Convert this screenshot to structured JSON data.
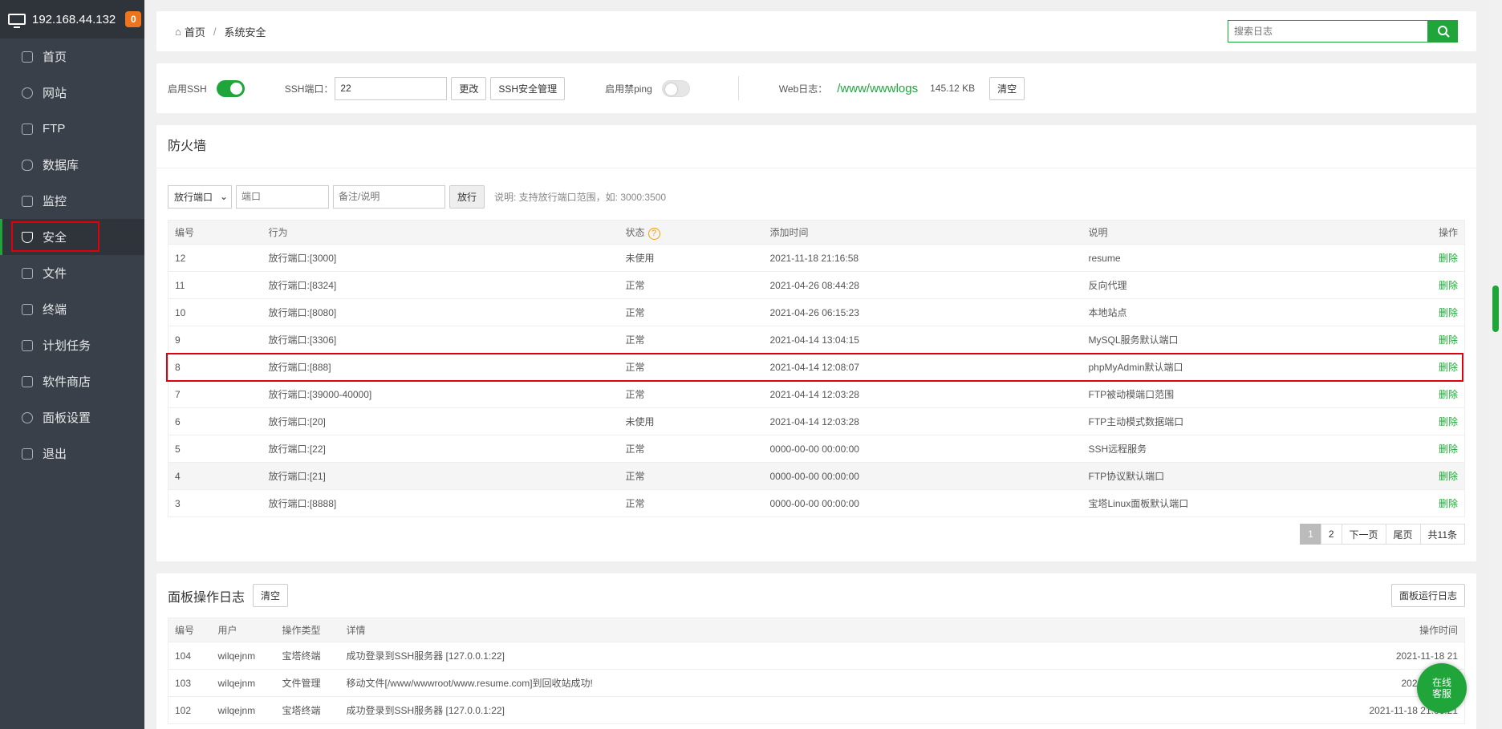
{
  "sidebar": {
    "ip": "192.168.44.132",
    "badge": "0",
    "items": [
      {
        "label": "首页",
        "icon": "home-icon"
      },
      {
        "label": "网站",
        "icon": "globe-icon"
      },
      {
        "label": "FTP",
        "icon": "ftp-icon"
      },
      {
        "label": "数据库",
        "icon": "database-icon"
      },
      {
        "label": "监控",
        "icon": "monitor-icon"
      },
      {
        "label": "安全",
        "icon": "shield-icon"
      },
      {
        "label": "文件",
        "icon": "folder-icon"
      },
      {
        "label": "终端",
        "icon": "terminal-icon"
      },
      {
        "label": "计划任务",
        "icon": "calendar-icon"
      },
      {
        "label": "软件商店",
        "icon": "grid-icon"
      },
      {
        "label": "面板设置",
        "icon": "gear-icon"
      },
      {
        "label": "退出",
        "icon": "logout-icon"
      }
    ]
  },
  "breadcrumb": {
    "home": "首页",
    "sep": "/",
    "current": "系统安全"
  },
  "search": {
    "placeholder": "搜索日志"
  },
  "options": {
    "ssh_label": "启用SSH",
    "ssh_port_label": "SSH端口：",
    "ssh_port_value": "22",
    "change_btn": "更改",
    "ssh_manage_btn": "SSH安全管理",
    "ping_label": "启用禁ping",
    "weblog_label": "Web日志：",
    "weblog_path": "/www/wwwlogs",
    "weblog_size": "145.12 KB",
    "clear_btn": "清空"
  },
  "firewall": {
    "title": "防火墙",
    "select_value": "放行端口",
    "port_placeholder": "端口",
    "note_placeholder": "备注/说明",
    "allow_btn": "放行",
    "hint": "说明: 支持放行端口范围，如: 3000:3500",
    "columns": [
      "编号",
      "行为",
      "状态",
      "添加时间",
      "说明",
      "操作"
    ],
    "rows": [
      {
        "id": "12",
        "action": "放行端口:[3000]",
        "status": "未使用",
        "time": "2021-11-18 21:16:58",
        "desc": "resume",
        "op": "删除"
      },
      {
        "id": "11",
        "action": "放行端口:[8324]",
        "status": "正常",
        "time": "2021-04-26 08:44:28",
        "desc": "反向代理",
        "op": "删除"
      },
      {
        "id": "10",
        "action": "放行端口:[8080]",
        "status": "正常",
        "time": "2021-04-26 06:15:23",
        "desc": "本地站点",
        "op": "删除"
      },
      {
        "id": "9",
        "action": "放行端口:[3306]",
        "status": "正常",
        "time": "2021-04-14 13:04:15",
        "desc": "MySQL服务默认端口",
        "op": "删除"
      },
      {
        "id": "8",
        "action": "放行端口:[888]",
        "status": "正常",
        "time": "2021-04-14 12:08:07",
        "desc": "phpMyAdmin默认端口",
        "op": "删除"
      },
      {
        "id": "7",
        "action": "放行端口:[39000-40000]",
        "status": "正常",
        "time": "2021-04-14 12:03:28",
        "desc": "FTP被动模端口范围",
        "op": "删除"
      },
      {
        "id": "6",
        "action": "放行端口:[20]",
        "status": "未使用",
        "time": "2021-04-14 12:03:28",
        "desc": "FTP主动模式数据端口",
        "op": "删除"
      },
      {
        "id": "5",
        "action": "放行端口:[22]",
        "status": "正常",
        "time": "0000-00-00 00:00:00",
        "desc": "SSH远程服务",
        "op": "删除"
      },
      {
        "id": "4",
        "action": "放行端口:[21]",
        "status": "正常",
        "time": "0000-00-00 00:00:00",
        "desc": "FTP协议默认端口",
        "op": "删除"
      },
      {
        "id": "3",
        "action": "放行端口:[8888]",
        "status": "正常",
        "time": "0000-00-00 00:00:00",
        "desc": "宝塔Linux面板默认端口",
        "op": "删除"
      }
    ],
    "pager": {
      "p1": "1",
      "p2": "2",
      "next": "下一页",
      "last": "尾页",
      "total": "共11条"
    }
  },
  "panel_log": {
    "title": "面板操作日志",
    "clear_btn": "清空",
    "run_log_btn": "面板运行日志",
    "columns": [
      "编号",
      "用户",
      "操作类型",
      "详情",
      "操作时间"
    ],
    "rows": [
      {
        "id": "104",
        "user": "wilqejnm",
        "type": "宝塔终端",
        "detail": "成功登录到SSH服务器 [127.0.0.1:22]",
        "time": "2021-11-18 21"
      },
      {
        "id": "103",
        "user": "wilqejnm",
        "type": "文件管理",
        "detail": "移动文件[/www/wwwroot/www.resume.com]到回收站成功!",
        "time": "2021-11-18 2"
      },
      {
        "id": "102",
        "user": "wilqejnm",
        "type": "宝塔终端",
        "detail": "成功登录到SSH服务器 [127.0.0.1:22]",
        "time": "2021-11-18 21:06:21"
      }
    ]
  },
  "chat": {
    "line1": "在线",
    "line2": "客服"
  }
}
